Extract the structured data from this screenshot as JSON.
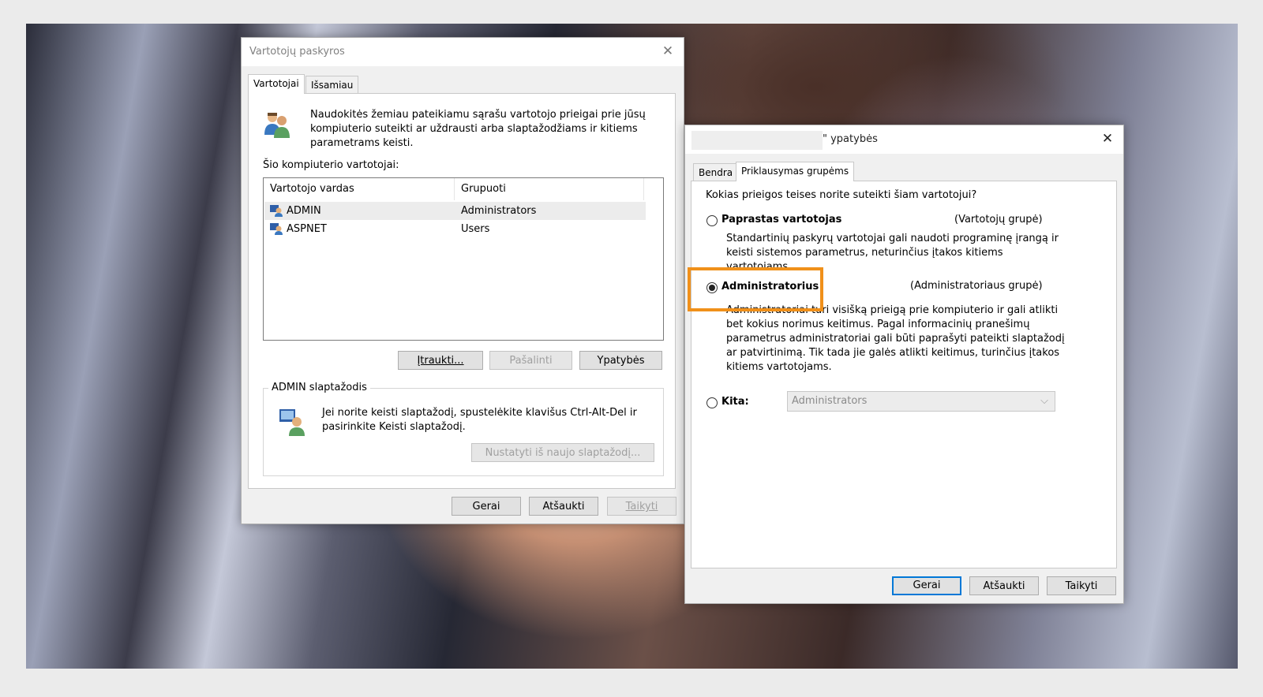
{
  "left_dialog": {
    "title": "Vartotojų paskyros",
    "tabs": [
      {
        "label": "Vartotojai",
        "active": true
      },
      {
        "label": "Išsamiau",
        "active": false
      }
    ],
    "intro_text": "Naudokitės žemiau pateikiamu sąrašu vartotojo prieigai prie jūsų kompiuterio suteikti ar uždrausti arba slaptažodžiams ir kitiems parametrams keisti.",
    "users_label": "Šio kompiuterio vartotojai:",
    "table": {
      "columns": [
        "Vartotojo vardas",
        "Grupuoti"
      ],
      "rows": [
        {
          "name": "ADMIN",
          "group": "Administrators",
          "selected": true
        },
        {
          "name": "ASPNET",
          "group": "Users",
          "selected": false
        }
      ]
    },
    "buttons": {
      "add": "Įtraukti...",
      "remove": "Pašalinti",
      "properties": "Ypatybės"
    },
    "password_group": {
      "label": "ADMIN slaptažodis",
      "text": "Jei norite keisti slaptažodį, spustelėkite klavišus Ctrl-Alt-Del ir pasirinkite Keisti slaptažodį.",
      "reset_button": "Nustatyti iš naujo slaptažodį..."
    },
    "footer": {
      "ok": "Gerai",
      "cancel": "Atšaukti",
      "apply": "Taikyti"
    }
  },
  "right_dialog": {
    "title_suffix": "\" ypatybės",
    "tabs": [
      {
        "label": "Bendra",
        "active": false
      },
      {
        "label": "Priklausymas grupėms",
        "active": true
      }
    ],
    "question": "Kokias prieigos teises norite suteikti šiam vartotojui?",
    "options": [
      {
        "label": "Paprastas vartotojas",
        "group": "(Vartotojų grupė)",
        "description": "Standartinių paskyrų vartotojai gali naudoti programinę įrangą ir keisti sistemos parametrus, neturinčius įtakos kitiems vartotojams.",
        "checked": false
      },
      {
        "label": "Administratorius",
        "group": "(Administratoriaus grupė)",
        "description": "Administratoriai turi visišką prieigą prie kompiuterio ir gali atlikti bet kokius norimus keitimus. Pagal informacinių pranešimų parametrus administratoriai gali būti paprašyti pateikti slaptažodį ar patvirtinimą. Tik tada jie galės atlikti keitimus, turinčius įtakos kitiems vartotojams.",
        "checked": true
      },
      {
        "label": "Kita:",
        "select_value": "Administrators",
        "checked": false
      }
    ],
    "footer": {
      "ok": "Gerai",
      "cancel": "Atšaukti",
      "apply": "Taikyti"
    }
  },
  "colors": {
    "highlight": "#f0901a",
    "focus_border": "#0078d7"
  },
  "icons": [
    "users-icon",
    "user-icon",
    "key-user-icon",
    "close-icon",
    "chevron-down-icon"
  ]
}
